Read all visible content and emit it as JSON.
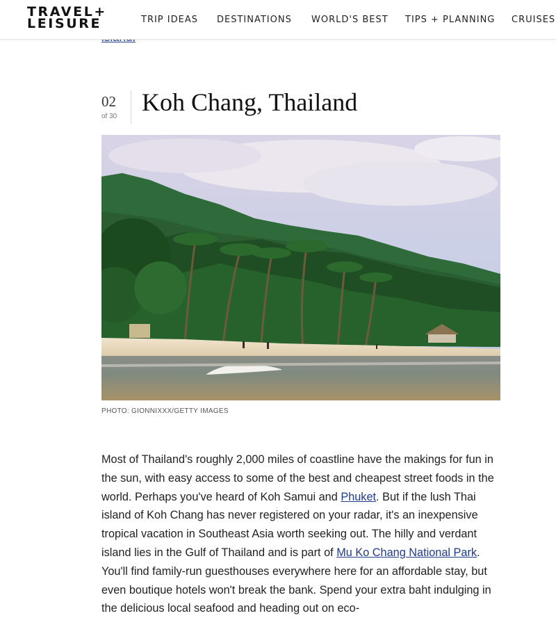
{
  "header": {
    "logo": {
      "line1": "TRAVEL+",
      "line2": "LEISURE"
    },
    "nav": [
      "TRIP IDEAS",
      "DESTINATIONS",
      "WORLD'S BEST",
      "TIPS + PLANNING",
      "CRUISES"
    ]
  },
  "article": {
    "prev_link_fragment": "island",
    "prev_link_punct": ".",
    "slide": {
      "number": "02",
      "of": "of 30"
    },
    "title": "Koh Chang, Thailand",
    "photo_credit": "PHOTO: GIONNIXXX/GETTY IMAGES",
    "body": {
      "p1": "Most of Thailand's roughly 2,000 miles of coastline have the makings for fun in the sun, with easy access to some of the best and cheapest street foods in the world. Perhaps you've heard of Koh Samui and ",
      "link1": "Phuket",
      "p2": ". But if the lush Thai island of Koh Chang has never registered on your radar, it's an inexpensive tropical vacation in Southeast Asia worth seeking out. The hilly and verdant island lies in the Gulf of Thailand and is part of ",
      "link2": "Mu Ko Chang National Park",
      "p3": ". You'll find family-run guesthouses everywhere here for an affordable stay, but even boutique hotels won't break the bank. Spend your extra baht indulging in the delicious local seafood and heading out on eco-"
    }
  },
  "colors": {
    "link": "#1e3a8a",
    "text": "#222222",
    "muted": "#777777"
  }
}
